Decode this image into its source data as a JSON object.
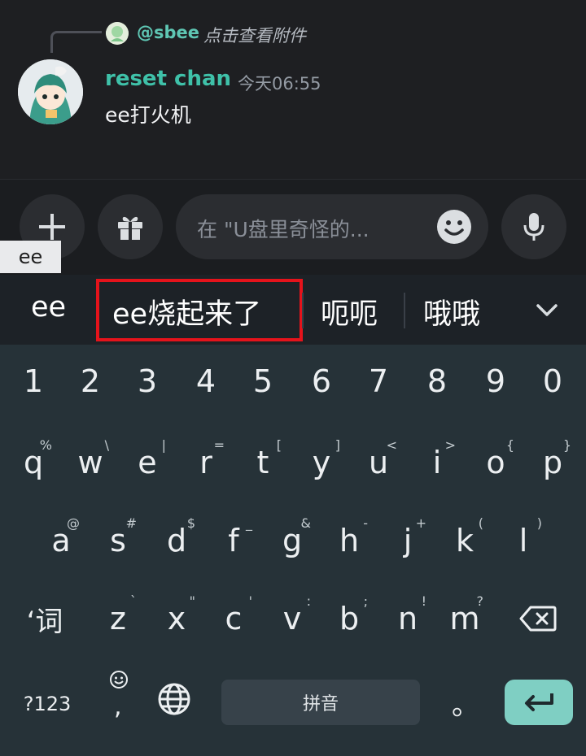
{
  "chat": {
    "reply": {
      "username": "@sbee",
      "text": "点击查看附件"
    },
    "message": {
      "username": "reset chan",
      "timestamp": "今天06:55",
      "text": "ee打火机"
    }
  },
  "input_bar": {
    "placeholder": "在 \"U盘里奇怪的...",
    "buttons": [
      "plus-icon",
      "gift-icon",
      "emoji-icon",
      "mic-icon"
    ]
  },
  "ime": {
    "composing": "ee",
    "suggestions": [
      "ee",
      "ee烧起来了",
      "呃呃",
      "哦哦"
    ],
    "highlighted_suggestion": "ee烧起来了",
    "highlight_color": "#e5131b"
  },
  "keyboard": {
    "number_row": [
      "1",
      "2",
      "3",
      "4",
      "5",
      "6",
      "7",
      "8",
      "9",
      "0"
    ],
    "row_q": [
      {
        "key": "q",
        "hint": "%"
      },
      {
        "key": "w",
        "hint": "\\"
      },
      {
        "key": "e",
        "hint": "|"
      },
      {
        "key": "r",
        "hint": "="
      },
      {
        "key": "t",
        "hint": "["
      },
      {
        "key": "y",
        "hint": "]"
      },
      {
        "key": "u",
        "hint": "<"
      },
      {
        "key": "i",
        "hint": ">"
      },
      {
        "key": "o",
        "hint": "{"
      },
      {
        "key": "p",
        "hint": "}"
      }
    ],
    "row_a": [
      {
        "key": "a",
        "hint": "@"
      },
      {
        "key": "s",
        "hint": "#"
      },
      {
        "key": "d",
        "hint": "$"
      },
      {
        "key": "f",
        "hint": "_"
      },
      {
        "key": "g",
        "hint": "&"
      },
      {
        "key": "h",
        "hint": "-"
      },
      {
        "key": "j",
        "hint": "+"
      },
      {
        "key": "k",
        "hint": "("
      },
      {
        "key": "l",
        "hint": ")"
      }
    ],
    "row_z": [
      {
        "key": "‘词",
        "hint": ""
      },
      {
        "key": "z",
        "hint": "`"
      },
      {
        "key": "x",
        "hint": "\""
      },
      {
        "key": "c",
        "hint": "'"
      },
      {
        "key": "v",
        "hint": ":"
      },
      {
        "key": "b",
        "hint": ";"
      },
      {
        "key": "n",
        "hint": "!"
      },
      {
        "key": "m",
        "hint": "?"
      }
    ],
    "symbols_label": "?123",
    "comma": ",",
    "space_label": "拼音",
    "period": "。",
    "accent_color": "#7fcfc3"
  }
}
